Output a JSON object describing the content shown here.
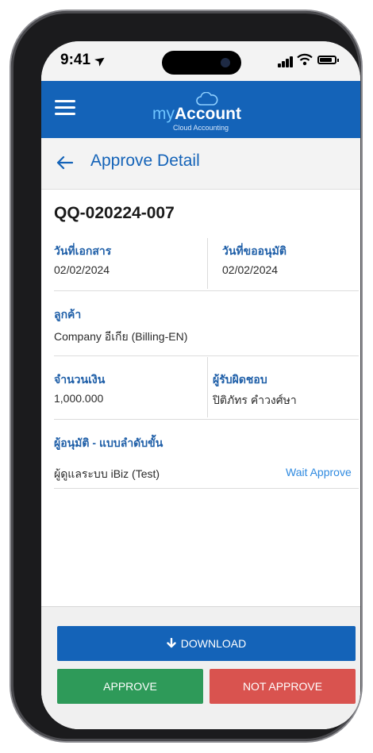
{
  "status_bar": {
    "time": "9:41"
  },
  "app": {
    "logo_my": "my",
    "logo_account": "Account",
    "logo_subtitle": "Cloud Accounting"
  },
  "header": {
    "title": "Approve Detail"
  },
  "document": {
    "number": "QQ-020224-007",
    "doc_date_label": "วันที่เอกสาร",
    "doc_date": "02/02/2024",
    "request_date_label": "วันที่ขออนุมัติ",
    "request_date": "02/02/2024",
    "customer_label": "ลูกค้า",
    "customer": "Company อีเกีย (Billing-EN)",
    "amount_label": "จำนวนเงิน",
    "amount": "1,000.000",
    "owner_label": "ผู้รับผิดชอบ",
    "owner": "ปิติภัทร คำวงศ์ษา",
    "approvers_label": "ผู้อนุมัติ - แบบลำดับขั้น",
    "approvers": [
      {
        "name": "ผู้ดูแลระบบ iBiz (Test)",
        "status": "Wait Approve"
      }
    ]
  },
  "actions": {
    "download_label": "DOWNLOAD",
    "approve_label": "APPROVE",
    "reject_label": "NOT APPROVE"
  },
  "colors": {
    "primary": "#1463b8",
    "approve": "#2e9a59",
    "reject": "#d9534f",
    "label": "#1f5fa8",
    "status": "#2f8ae0"
  },
  "icons": [
    "menu-icon",
    "back-arrow-icon",
    "download-icon",
    "cloud-icon",
    "location-arrow-icon",
    "signal-icon",
    "wifi-icon",
    "battery-icon"
  ]
}
